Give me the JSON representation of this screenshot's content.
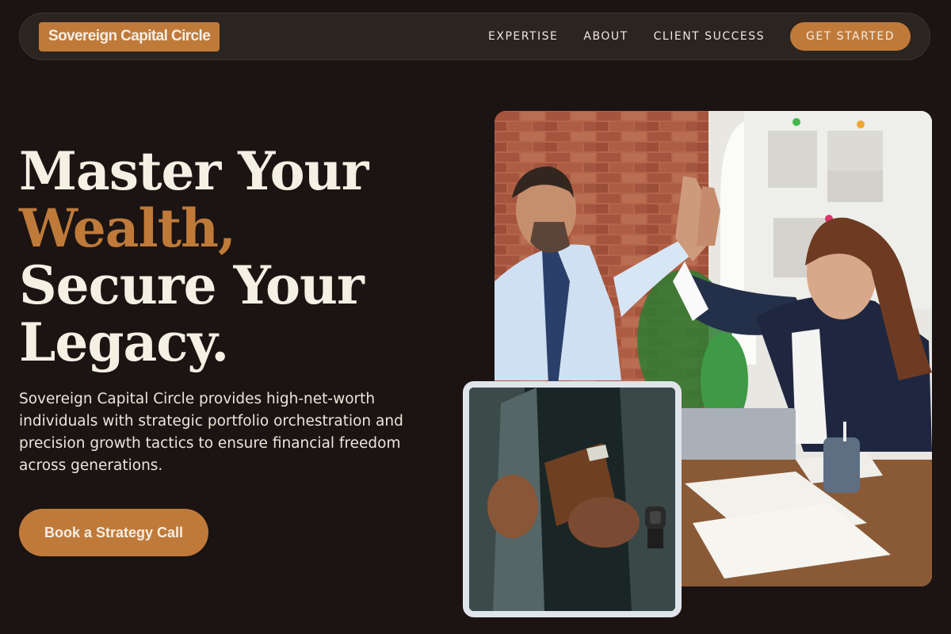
{
  "brand": {
    "name": "Sovereign Capital Circle"
  },
  "nav": {
    "links": [
      "EXPERTISE",
      "ABOUT",
      "CLIENT SUCCESS"
    ],
    "cta": "GET STARTED"
  },
  "hero": {
    "headline": {
      "line1": "Master Your",
      "accent": "Wealth,",
      "line3": "Secure Your",
      "line4": "Legacy."
    },
    "description": "Sovereign Capital Circle provides high-net-worth individuals with strategic portfolio orchestration and precision growth tactics to ensure financial freedom across generations.",
    "cta": "Book a Strategy Call"
  },
  "colors": {
    "background": "#1b1412",
    "accent": "#bf7a3a",
    "nav_bg": "#2b2420",
    "text": "#f6efe4"
  },
  "images": {
    "main": "business-team-high-five-photo",
    "inset": "man-holding-leather-wallet-photo"
  }
}
